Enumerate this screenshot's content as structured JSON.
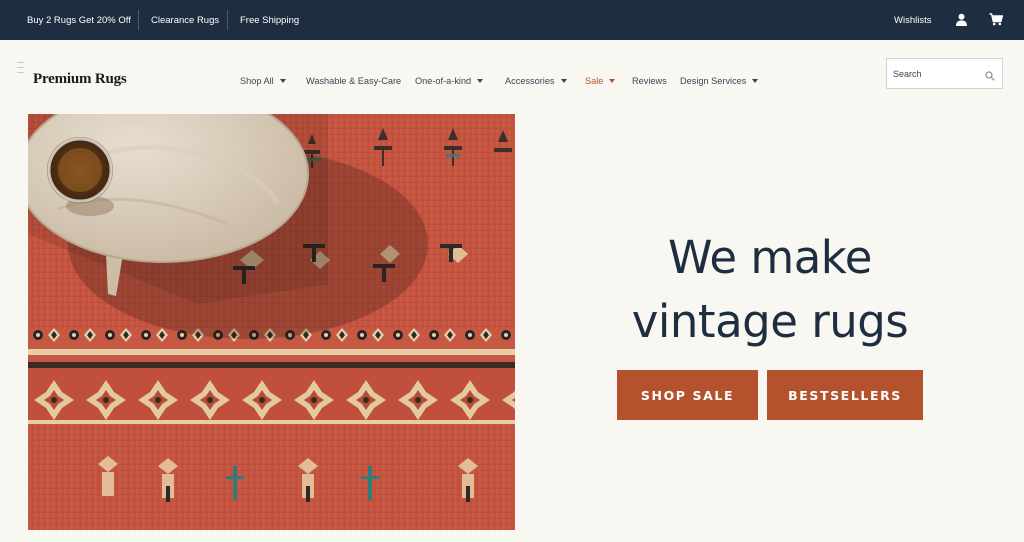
{
  "topbar": {
    "promo_bundle": "Buy 2 Rugs Get 20% Off",
    "promo_clearance": "Clearance Rugs",
    "promo_shipping": "Free Shipping",
    "wishlists": "Wishlists",
    "account_icon": "user-icon",
    "cart_icon": "cart-icon"
  },
  "header": {
    "logo": "Premium Rugs",
    "menu_icon": "hamburger-icon",
    "search_placeholder": "Search",
    "search_icon": "magnifier-icon"
  },
  "nav": {
    "items": [
      {
        "label": "Shop All",
        "dropdown": true
      },
      {
        "label": "Washable & Easy-Care",
        "dropdown": false
      },
      {
        "label": "One-of-a-kind",
        "dropdown": true
      },
      {
        "label": "Accessories",
        "dropdown": true
      },
      {
        "label": "Sale",
        "dropdown": true
      },
      {
        "label": "Reviews",
        "dropdown": false
      },
      {
        "label": "Design Services",
        "dropdown": true
      }
    ]
  },
  "hero": {
    "headline_line1": "We make",
    "headline_line2": "vintage rugs",
    "cta_primary": "SHOP SALE",
    "cta_secondary": "BESTSELLERS"
  },
  "colors": {
    "topbar_bg": "#1e2d40",
    "page_bg": "#f9f7f2",
    "accent": "#b4522e",
    "headline": "#1e2d40"
  }
}
